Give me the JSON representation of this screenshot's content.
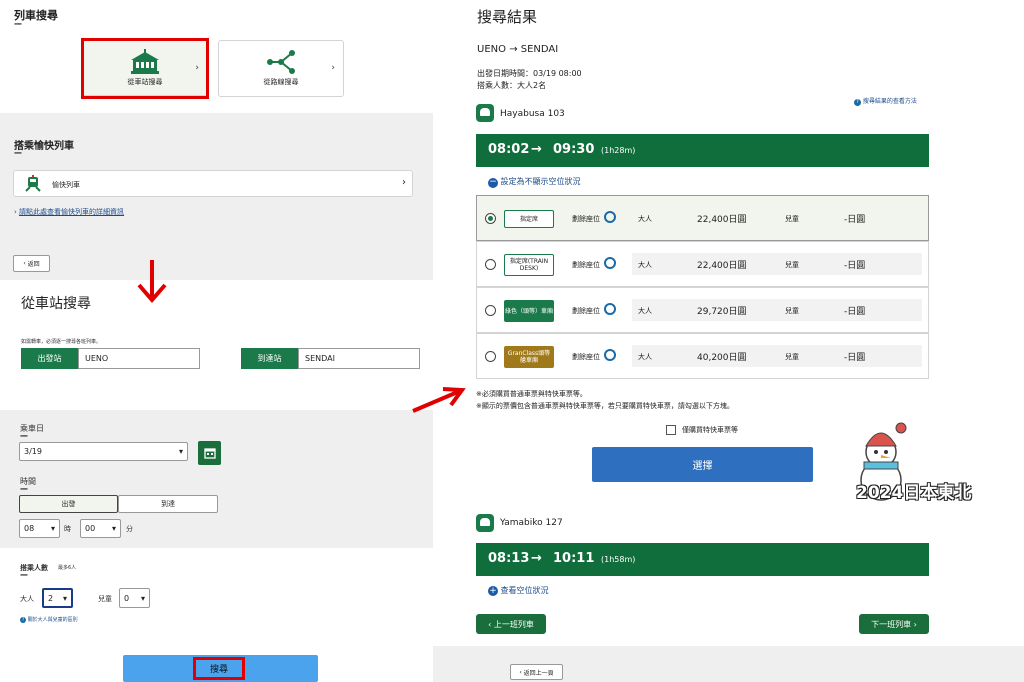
{
  "left": {
    "section_title": "列車搜尋",
    "dash": "---",
    "tab_station": "從車站搜尋",
    "tab_route": "從路線搜尋",
    "limited_title": "搭乘愉快列車",
    "limited_item": "愉快列車",
    "limited_link": "請點此處查看愉快列車的詳細資訊",
    "back": "返回",
    "station_title": "從車站搜尋",
    "station_note": "如需轉車，必須逐一搜尋各班列車。",
    "depart_label": "出發站",
    "depart_value": "UENO",
    "arrive_label": "到達站",
    "arrive_value": "SENDAI",
    "date_label": "乘車日",
    "date_value": "3/19",
    "time_label": "時間",
    "time_depart": "出發",
    "time_arrive": "到達",
    "hour": "08",
    "hour_unit": "時",
    "minute": "00",
    "minute_unit": "分",
    "pax_label": "搭乘人數",
    "pax_max": "最多6人",
    "adult_label": "大人",
    "adult_value": "2",
    "child_label": "兒童",
    "child_value": "0",
    "pax_link": "關於大人與兒童的區別",
    "search": "搜尋"
  },
  "right": {
    "title": "搜尋結果",
    "route_from": "UENO",
    "route_arrow": "→",
    "route_to": "SENDAI",
    "depart_info": "出發日期時間：03/19 08:00",
    "pax_info": "搭乘人數：大人2名",
    "help_link": "搜尋結果的查看方法",
    "train1": "Hayabusa 103",
    "train1_dep": "08:02",
    "train1_arr": "09:30",
    "train1_dur": "(1h28m)",
    "toggle_link": "設定為不顯示空位狀況",
    "seat_text": "劃餘座位",
    "adult": "大人",
    "child": "兒童",
    "rows": [
      {
        "badge": "指定席",
        "price": "22,400日圓",
        "child_price": "-日圓"
      },
      {
        "badge": "指定席(TRAIN DESK)",
        "price": "22,400日圓",
        "child_price": "-日圓"
      },
      {
        "badge": "綠色（頭等）車廂",
        "price": "29,720日圓",
        "child_price": "-日圓"
      },
      {
        "badge": "GranClass頭等艙車廂",
        "price": "40,200日圓",
        "child_price": "-日圓"
      }
    ],
    "note1": "※必須購買普通車票與特快車票等。",
    "note2": "※顯示的票價包含普通車票與特快車票等，若只要購買特快車票，請勾選以下方塊。",
    "only_express": "僅購買特快車票等",
    "select": "選擇",
    "train2": "Yamabiko 127",
    "train2_dep": "08:13",
    "train2_arr": "10:11",
    "train2_dur": "(1h58m)",
    "view_seats": "查看空位狀況",
    "prev": "上一班列車",
    "next": "下一班列車",
    "back": "返回上一頁",
    "watermark": "2024日本東北"
  },
  "colors": {
    "green": "#0f6e3c",
    "blue": "#2e6fbf",
    "red": "#e00000",
    "lightblue": "#4aa3ec"
  }
}
